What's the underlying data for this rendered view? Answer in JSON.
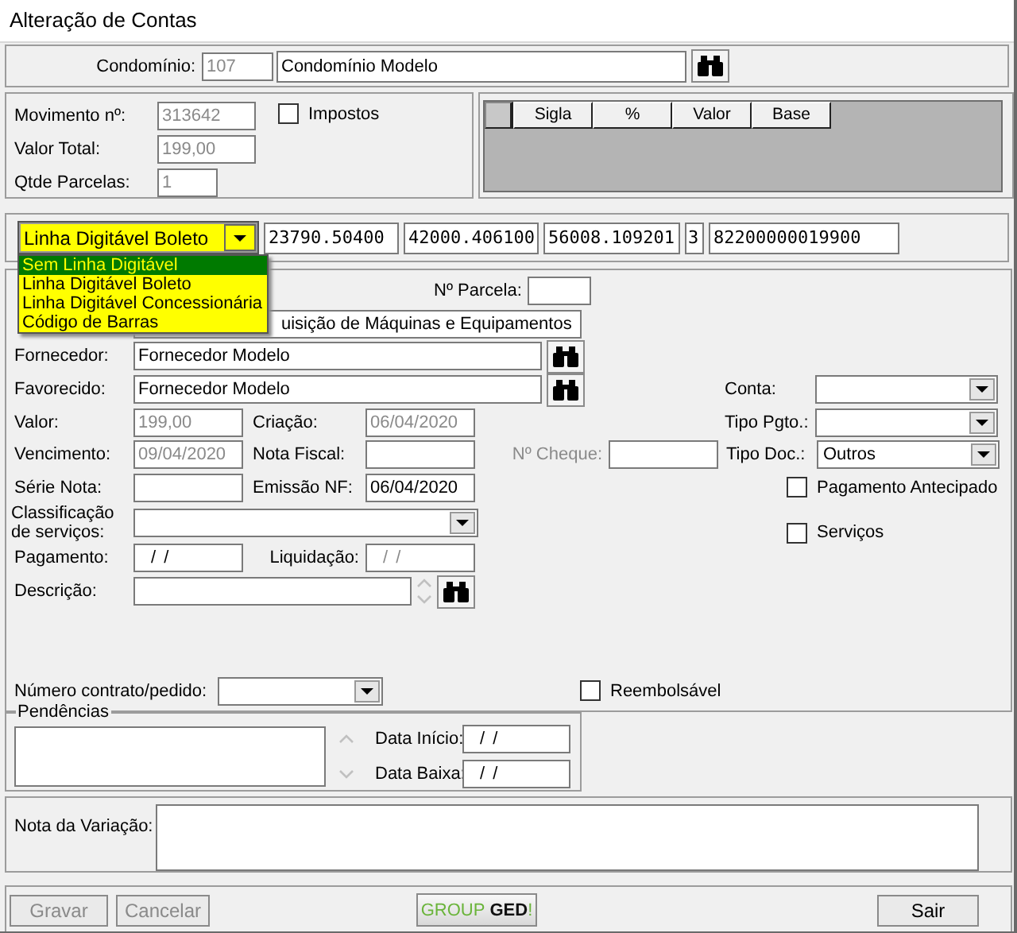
{
  "window": {
    "title": "Alteração de Contas"
  },
  "condominio": {
    "label": "Condomínio:",
    "code": "107",
    "name": "Condomínio Modelo"
  },
  "movimento": {
    "fields": [
      {
        "label": "Movimento nº:",
        "value": "313642",
        "disabled": true
      },
      {
        "label": "Valor Total:",
        "value": "199,00",
        "disabled": true
      },
      {
        "label": "Qtde Parcelas:",
        "value": "1",
        "disabled": true
      }
    ],
    "impostos": {
      "label": "Impostos",
      "checked": false
    }
  },
  "tax_grid": {
    "columns": [
      "Sigla",
      "%",
      "Valor",
      "Base"
    ]
  },
  "barcode": {
    "type_select": {
      "value": "Linha Digitável Boleto",
      "expanded": true,
      "options": [
        {
          "label": "Sem Linha Digitável",
          "highlighted": true
        },
        {
          "label": "Linha Digitável Boleto",
          "highlighted": false
        },
        {
          "label": "Linha Digitável Concessionária",
          "highlighted": false
        },
        {
          "label": "Código de Barras",
          "highlighted": false
        }
      ]
    },
    "fields": [
      "23790.50400",
      "42000.406100",
      "56008.109201",
      "3",
      "82200000019900"
    ]
  },
  "details": {
    "parcela": {
      "label": "Nº Parcela:"
    },
    "account": {
      "value": "uisição de Máquinas e Equipamentos"
    },
    "fornecedor": {
      "label": "Fornecedor:",
      "value": "Fornecedor Modelo"
    },
    "favorecido": {
      "label": "Favorecido:",
      "value": "Fornecedor Modelo"
    },
    "valor": {
      "label": "Valor:",
      "value": "199,00",
      "disabled": true
    },
    "criacao": {
      "label": "Criação:",
      "value": "06/04/2020",
      "disabled": true
    },
    "vencimento": {
      "label": "Vencimento:",
      "value": "09/04/2020",
      "disabled": true
    },
    "nota_fiscal": {
      "label": "Nota Fiscal:"
    },
    "cheque": {
      "label": "Nº Cheque:",
      "disabled": true
    },
    "serie_nota": {
      "label": "Série Nota:"
    },
    "emissao_nf": {
      "label": "Emissão NF:",
      "value": "06/04/2020",
      "disabled": false
    },
    "classificacao": {
      "label": "Classificação de serviços:"
    },
    "pagamento": {
      "label": "Pagamento:",
      "value": "/ /",
      "disabled": false
    },
    "liquidacao": {
      "label": "Liquidação:",
      "value": "/ /",
      "disabled": true
    },
    "descricao": {
      "label": "Descrição:"
    },
    "conta": {
      "label": "Conta:"
    },
    "tipo_pgto": {
      "label": "Tipo Pgto.:"
    },
    "tipo_doc": {
      "label": "Tipo Doc.:",
      "value": "Outros"
    },
    "options": [
      {
        "label": "Pagamento Antecipado",
        "checked": false
      },
      {
        "label": "Serviços",
        "checked": false
      }
    ],
    "contrato": {
      "label": "Número contrato/pedido:"
    },
    "reembolsavel": {
      "label": "Reembolsável",
      "checked": false
    }
  },
  "pendencias": {
    "title": "Pendências",
    "dates": [
      {
        "label": "Data Início:",
        "value": "/ /"
      },
      {
        "label": "Data Baixa:",
        "value": "/ /"
      }
    ]
  },
  "nota_variacao": {
    "label": "Nota da Variação:"
  },
  "buttons": [
    {
      "kind": "button",
      "label": "Gravar",
      "disabled": true
    },
    {
      "kind": "button",
      "label": "Cancelar",
      "disabled": true
    },
    {
      "kind": "logo",
      "parts": [
        "GROUP",
        "GED",
        "!"
      ]
    },
    {
      "kind": "button",
      "label": "Sair",
      "disabled": false
    }
  ]
}
